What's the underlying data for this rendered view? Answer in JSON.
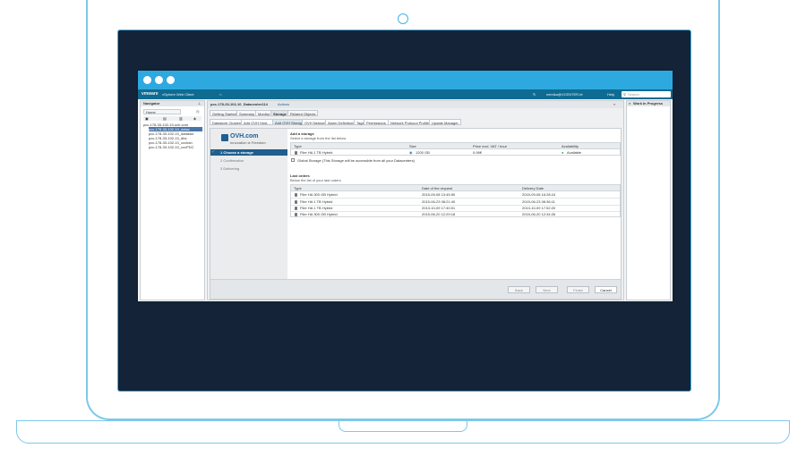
{
  "window": {
    "brand": "vmware",
    "product": "vSphere Web Client",
    "home_glyph": "⌂",
    "user": "mireika@VCENTER-fe",
    "help": "Help",
    "search_placeholder": "Search"
  },
  "navigator": {
    "title": "Navigator",
    "home": "Home",
    "items": [
      "pcc-178-33-102-10.ovh.com",
      "pcc-178-33-102-10_datac",
      "pcc-178-33-102-10_datastor",
      "pcc-178-33-102-10_dbs",
      "pcc-178-33-102-10_ccchan",
      "pcc-178-33-102-10_cccPDC"
    ]
  },
  "object": {
    "title": "pcc-178-33-102-10_Datacenter114",
    "actions": "Actions"
  },
  "tabs": [
    "Getting Started",
    "Summary",
    "Monitor",
    "Storage",
    "Related Objects"
  ],
  "active_tab": "Storage",
  "subtabs": [
    "Datastore Clusters",
    "Add OVH Host...",
    "Add OVH Storage",
    "OVH Network",
    "Alarm Definitions",
    "Tags",
    "Permissions",
    "Network Protocol Profiles",
    "Update Manager"
  ],
  "active_subtab": "Add OVH Storage",
  "wizard": {
    "logo_text": "OVH.com",
    "logo_tagline": "Innovation is Freedom",
    "steps": [
      "1 Choose a storage",
      "2 Confirmation",
      "3 Delivering"
    ],
    "add_storage_title": "Add a storage",
    "add_storage_sub": "Select a storage from the list below",
    "storage_columns": [
      "Type",
      "Size",
      "Price excl. VAT / hour",
      "Availability"
    ],
    "storage_rows": [
      {
        "type": "Filer HA 1 TB Hybrid",
        "size": "1200 GB",
        "price": "0.06€",
        "availability": "Available"
      }
    ],
    "global_storage_label": "Global Storage (This Storage will be accessible from all your Datacenters)",
    "last_orders_title": "Last orders",
    "last_orders_sub": "Below the list of your last orders",
    "orders_columns": [
      "Type",
      "Date of the request",
      "Delivery Date"
    ],
    "orders_rows": [
      {
        "type": "Filer HA 300 GB Hybrid",
        "request": "2015-09-08 13:45:50",
        "delivery": "2015-09-08 16:28:24"
      },
      {
        "type": "Filer HA 1 TB Hybrid",
        "request": "2015-06-23 08:21:40",
        "delivery": "2015-06-23 08:36:11"
      },
      {
        "type": "Filer HA 1 TB Hybrid",
        "request": "2013-10-09 17:40:01",
        "delivery": "2013-10-09 17:52:20"
      },
      {
        "type": "Filer HA 300 GB Hybrid",
        "request": "2015-06-20 12:29:18",
        "delivery": "2015-06-20 12:34:26"
      }
    ],
    "buttons": {
      "back": "Back",
      "next": "Next",
      "finish": "Finish",
      "cancel": "Cancel"
    }
  },
  "right_panel": {
    "title": "Work In Progress"
  },
  "colors": {
    "titlebar": "#2ea9e0",
    "appbar": "#0f6b91",
    "bezel": "#142337",
    "outline": "#7ec8ea"
  }
}
